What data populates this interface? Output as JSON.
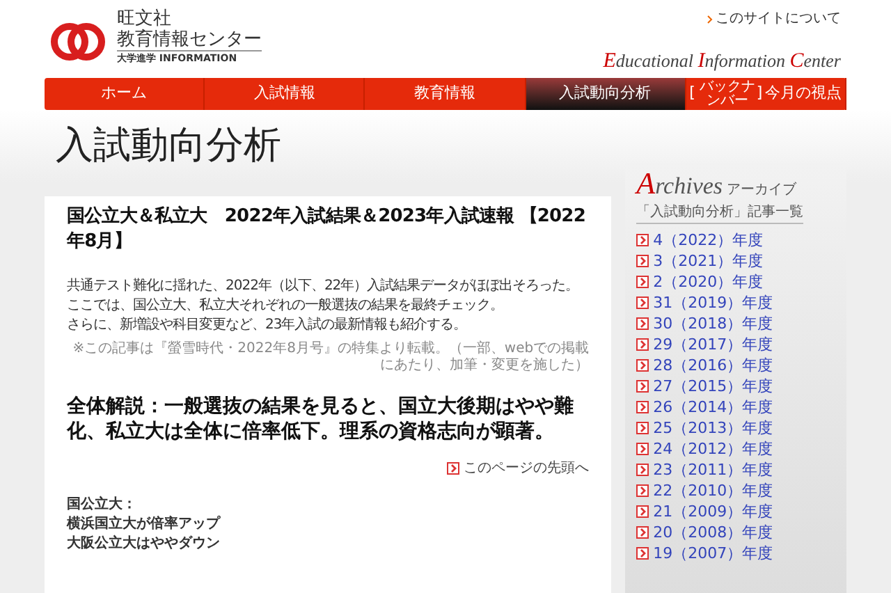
{
  "header": {
    "logo_line1": "旺文社",
    "logo_line2": "教育情報センター",
    "logo_sub": "大学進学 INFORMATION",
    "about_link": "このサイトについて",
    "tagline_parts": [
      {
        "initial": "E",
        "rest": "ducational "
      },
      {
        "initial": "I",
        "rest": "nformation "
      },
      {
        "initial": "C",
        "rest": "enter"
      }
    ]
  },
  "nav": [
    {
      "label": "ホーム",
      "selected": false
    },
    {
      "label": "入試情報",
      "selected": false
    },
    {
      "label": "教育情報",
      "selected": false
    },
    {
      "label": "入試動向分析",
      "selected": true
    },
    {
      "label": "今月の視点",
      "selected": false,
      "bracket_open": "[",
      "bracket_note": "バックナンバー",
      "bracket_close": "]"
    }
  ],
  "page_title": "入試動向分析",
  "article": {
    "title": "国公立大＆私立大　2022年入試結果＆2023年入試速報 【2022年8月】",
    "intro": [
      "共通テスト難化に揺れた、2022年（以下、22年）入試結果データがほぼ出そろった。",
      "ここでは、国公立大、私立大それぞれの一般選抜の結果を最終チェック。",
      "さらに、新増設や科目変更など、23年入試の最新情報も紹介する。"
    ],
    "note": "※この記事は『螢雪時代・2022年8月号』の特集より転載。（一部、webでの掲載にあたり、加筆・変更を施した）",
    "section_title": "全体解説：一般選抜の結果を見ると、国立大後期はやや難化、私立大は全体に倍率低下。理系の資格志向が顕著。",
    "top_link": "このページの先頭へ",
    "summary": [
      "国公立大：",
      "横浜国立大が倍率アップ",
      "大阪公立大はややダウン"
    ]
  },
  "archives": {
    "title_initial": "A",
    "title_rest": "rchives",
    "title_kana": "アーカイブ",
    "subtitle": "「入試動向分析」記事一覧",
    "items": [
      "4（2022）年度",
      "3（2021）年度",
      "2（2020）年度",
      "31（2019）年度",
      "30（2018）年度",
      "29（2017）年度",
      "28（2016）年度",
      "27（2015）年度",
      "26（2014）年度",
      "25（2013）年度",
      "24（2012）年度",
      "23（2011）年度",
      "22（2010）年度",
      "21（2009）年度",
      "20（2008）年度",
      "19（2007）年度"
    ]
  }
}
